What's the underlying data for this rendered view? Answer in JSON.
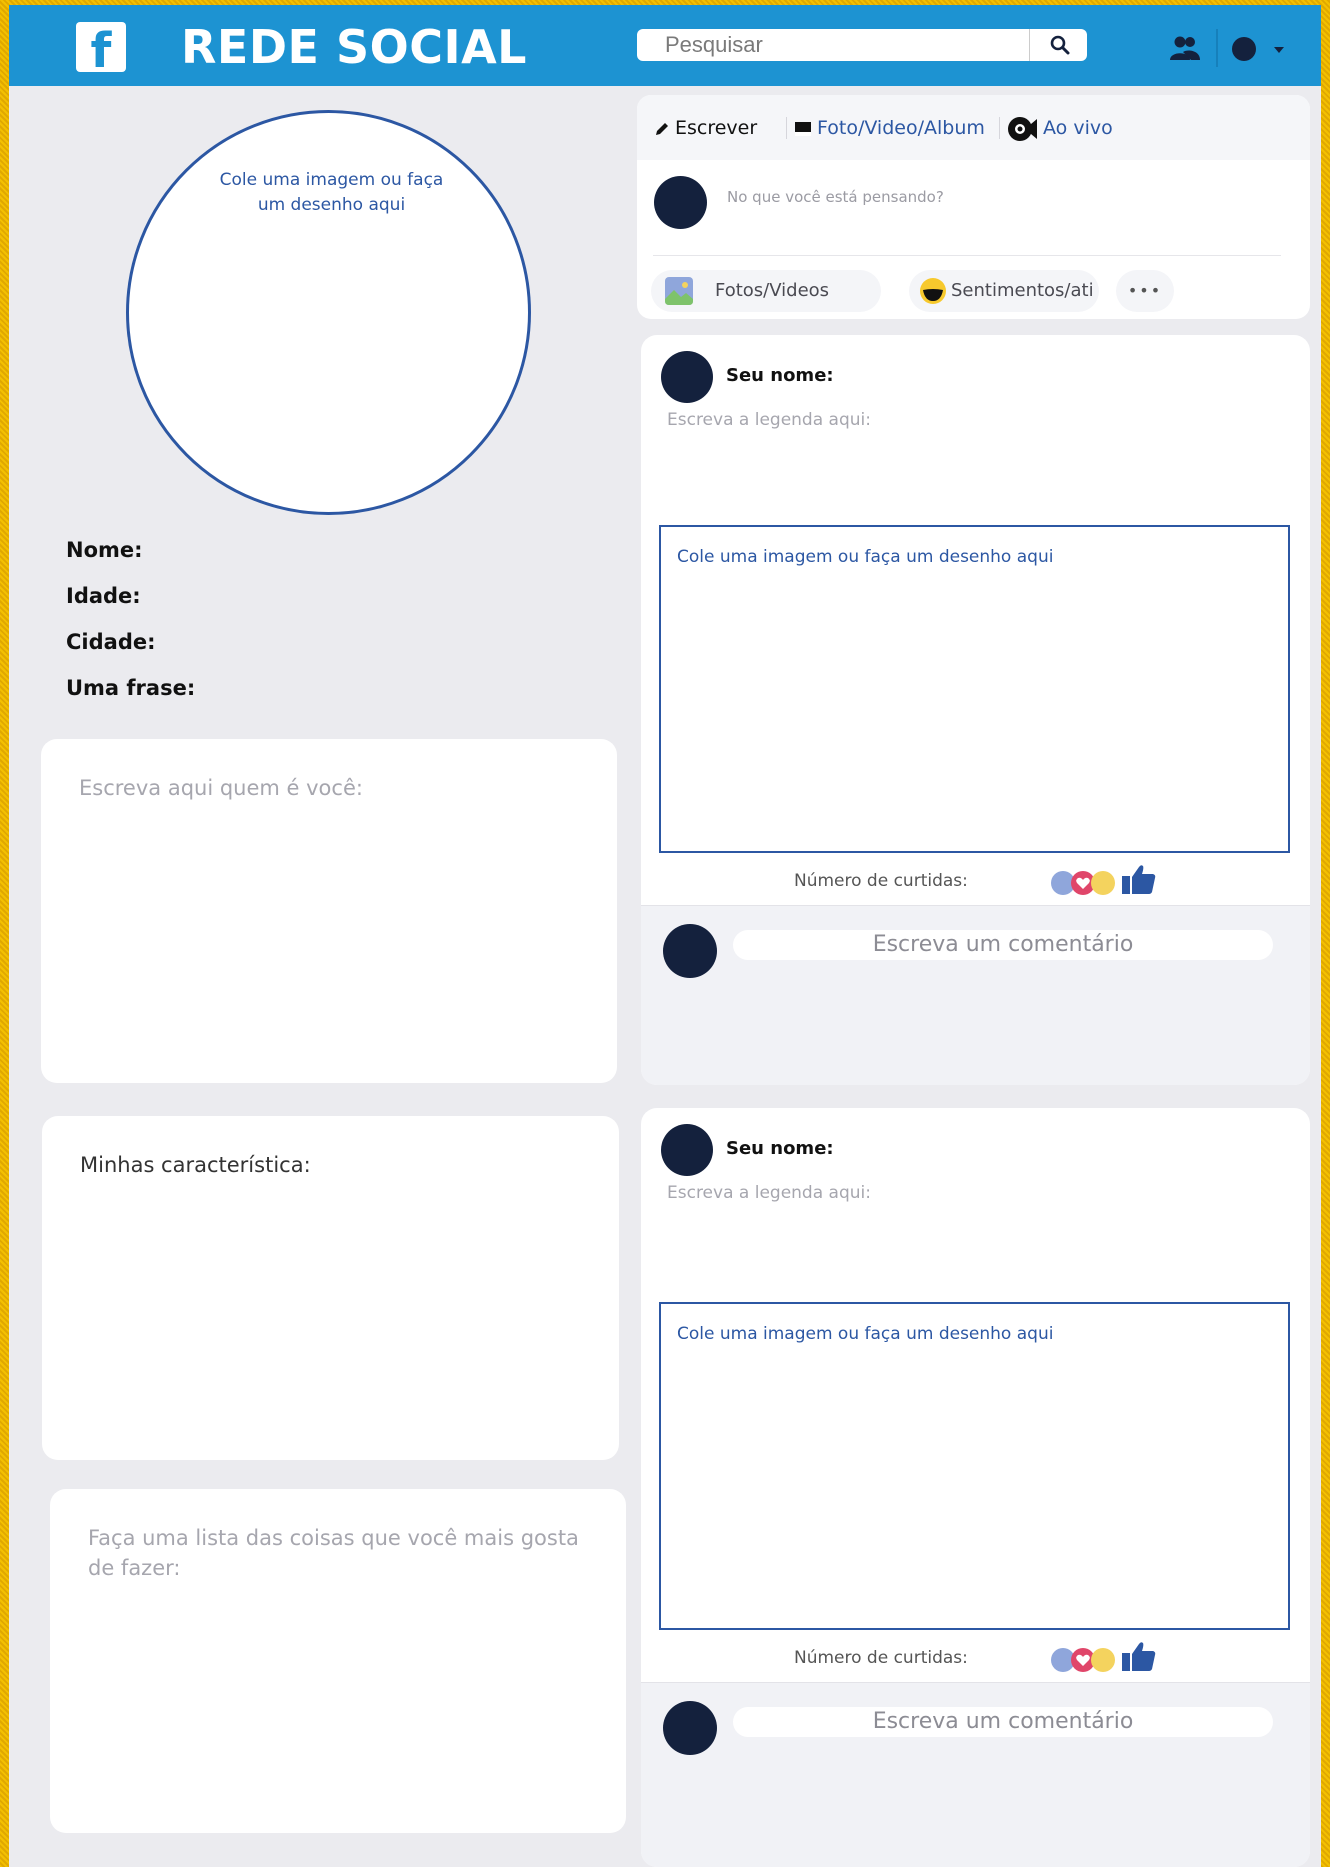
{
  "header": {
    "logo_letter": "f",
    "brand": "REDE SOCIAL",
    "search_placeholder": "Pesquisar"
  },
  "profile": {
    "photo_prompt": "Cole uma imagem ou faça um desenho aqui",
    "fields": [
      "Nome:",
      "Idade:",
      "Cidade:",
      "Uma frase:"
    ],
    "about_prompt": "Escreva aqui quem é você:",
    "traits_prompt": "Minhas característica:",
    "likes_prompt": "Faça uma lista das coisas que você mais gosta de fazer:"
  },
  "composer": {
    "tabs": [
      "Escrever",
      "Foto/Video/Album",
      "Ao vivo"
    ],
    "prompt": "No que você está pensando?",
    "actions": [
      "Fotos/Videos",
      "Sentimentos/ati",
      "•••"
    ]
  },
  "posts": [
    {
      "name_label": "Seu nome:",
      "caption": "Escreva a legenda aqui:",
      "image_prompt": "Cole uma imagem ou faça um desenho aqui",
      "likes_label": "Número de curtidas:",
      "comment_placeholder": "Escreva um comentário"
    },
    {
      "name_label": "Seu nome:",
      "caption": "Escreva a legenda aqui:",
      "image_prompt": "Cole uma imagem ou faça um desenho aqui",
      "likes_label": "Número de curtidas:",
      "comment_placeholder": "Escreva um comentário"
    }
  ],
  "colors": {
    "header_blue": "#1d93d2",
    "border_frame": "#f5c200",
    "accent_blue": "#2c57a3",
    "avatar_dark": "#14213d"
  },
  "icons": {
    "logo": "facebook-logo-icon",
    "search": "search-icon",
    "friends": "friends-icon",
    "write": "pencil-icon",
    "photo": "photo-album-icon",
    "live": "live-video-icon",
    "image": "image-icon",
    "feeling": "smiley-icon",
    "like": "thumbs-up-icon",
    "love": "heart-icon"
  }
}
